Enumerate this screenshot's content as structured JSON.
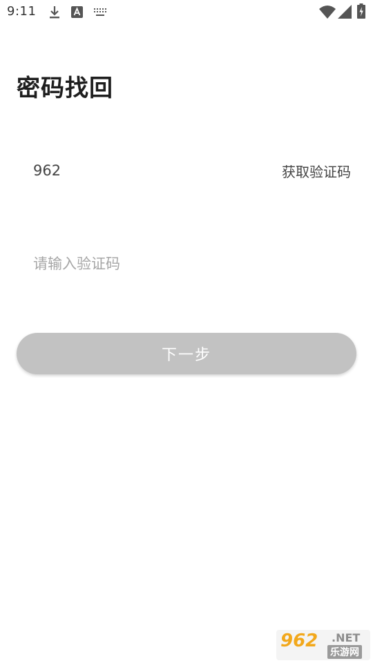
{
  "status_bar": {
    "time": "9:11",
    "icons": [
      "download-icon",
      "a-badge-icon",
      "keyboard-icon",
      "wifi-icon",
      "signal-icon",
      "battery-charging-icon"
    ]
  },
  "page": {
    "title": "密码找回"
  },
  "form": {
    "phone_value": "962",
    "get_code_label": "获取验证码",
    "code_placeholder": "请输入验证码",
    "code_value": "",
    "next_label": "下一步"
  },
  "watermark": {
    "digits": "962",
    "net": ".NET",
    "cn": "乐游网"
  },
  "colors": {
    "button_disabled": "#c2c2c2",
    "placeholder": "#a6a6a6",
    "text": "#222222"
  }
}
